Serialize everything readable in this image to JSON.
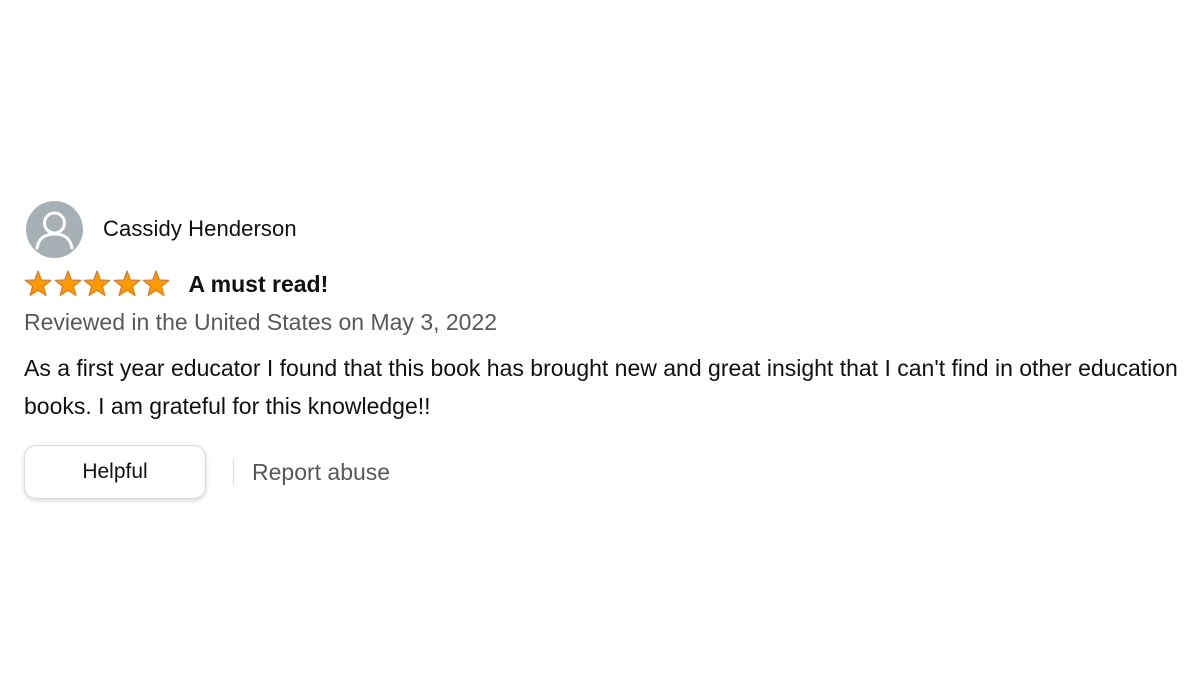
{
  "review": {
    "reviewer_name": "Cassidy Henderson",
    "avatar_icon": "default-profile-icon",
    "rating": 5,
    "rating_max": 5,
    "star_color": "#ff9900",
    "title": "A must read!",
    "date_text": "Reviewed in the United States on May 3, 2022",
    "body": "As a first year educator I found that this book has brought new and great insight that I can't find in other education books. I am grateful for this knowledge!!"
  },
  "actions": {
    "helpful_label": "Helpful",
    "report_label": "Report abuse"
  }
}
